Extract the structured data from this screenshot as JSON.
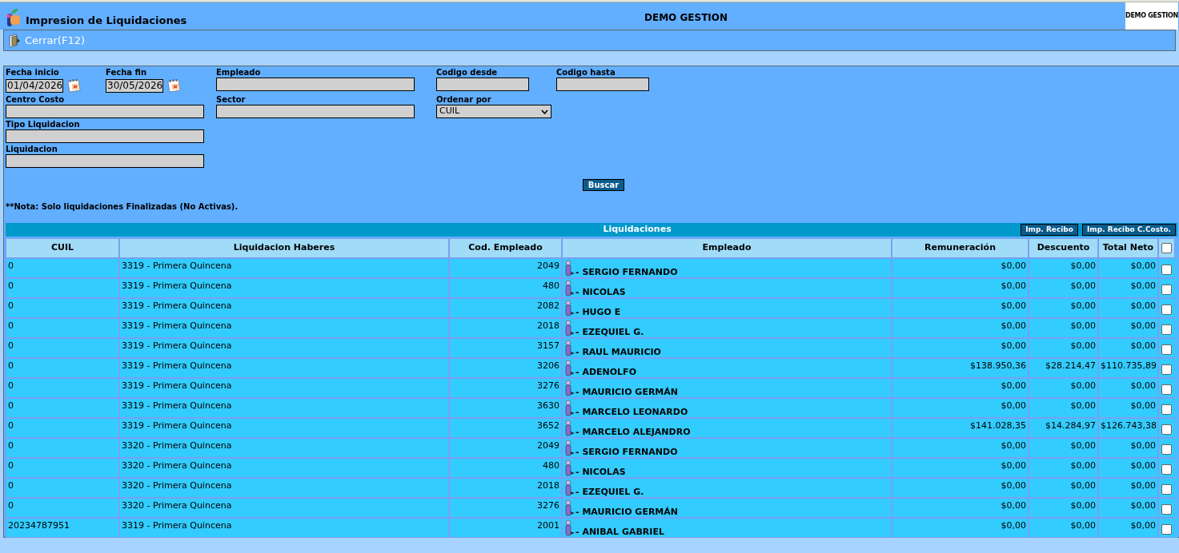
{
  "header": {
    "title": "Impresion de Liquidaciones",
    "company": "DEMO GESTION",
    "logo_text": "DEMO GESTION"
  },
  "toolbar": [
    {
      "label": "Cerrar(F12)"
    }
  ],
  "filters": [
    [
      {
        "label": "Fecha inicio",
        "kind": "date",
        "value": "01/04/2026"
      },
      {
        "label": "Fecha fin",
        "kind": "date",
        "value": "30/05/2026"
      },
      {
        "label": "Empleado",
        "kind": "text"
      },
      {
        "label": "Codigo desde",
        "kind": "short"
      },
      {
        "label": "Codigo hasta",
        "kind": "short"
      }
    ],
    [
      {
        "label": "Centro Costo",
        "kind": "text"
      },
      {
        "label": "Sector",
        "kind": "text"
      },
      {
        "label": "Ordenar por",
        "kind": "select",
        "value": "CUIL"
      }
    ],
    [
      {
        "label": "Tipo Liquidacion",
        "kind": "text"
      }
    ],
    [
      {
        "label": "Liquidacion",
        "kind": "text"
      }
    ]
  ],
  "search_button": "Buscar",
  "note": "**Nota: Solo liquidaciones Finalizadas (No Activas).",
  "table": {
    "title": "Liquidaciones",
    "actions": [
      "Imp. Recibo",
      "Imp. Recibo C.Costo."
    ],
    "columns": [
      "CUIL",
      "Liquidacion Haberes",
      "Cod. Empleado",
      "Empleado",
      "Remuneración",
      "Descuento",
      "Total Neto"
    ],
    "select_all_checked": false,
    "rows": [
      {
        "cuil": "0",
        "liquidacion": "3319 - Primera Quincena",
        "codigo": "2049",
        "empleado": "- SERGIO FERNANDO",
        "remuneracion": "$0,00",
        "descuento": "$0,00",
        "neto": "$0,00",
        "checked": false
      },
      {
        "cuil": "0",
        "liquidacion": "3319 - Primera Quincena",
        "codigo": "480",
        "empleado": "- NICOLAS",
        "remuneracion": "$0,00",
        "descuento": "$0,00",
        "neto": "$0,00",
        "checked": false
      },
      {
        "cuil": "0",
        "liquidacion": "3319 - Primera Quincena",
        "codigo": "2082",
        "empleado": "- HUGO E",
        "remuneracion": "$0,00",
        "descuento": "$0,00",
        "neto": "$0,00",
        "checked": false
      },
      {
        "cuil": "0",
        "liquidacion": "3319 - Primera Quincena",
        "codigo": "2018",
        "empleado": "- EZEQUIEL G.",
        "remuneracion": "$0,00",
        "descuento": "$0,00",
        "neto": "$0,00",
        "checked": false
      },
      {
        "cuil": "0",
        "liquidacion": "3319 - Primera Quincena",
        "codigo": "3157",
        "empleado": "- RAUL MAURICIO",
        "remuneracion": "$0,00",
        "descuento": "$0,00",
        "neto": "$0,00",
        "checked": false
      },
      {
        "cuil": "0",
        "liquidacion": "3319 - Primera Quincena",
        "codigo": "3206",
        "empleado": "- ADENOLFO",
        "remuneracion": "$138.950,36",
        "descuento": "$28.214,47",
        "neto": "$110.735,89",
        "checked": false
      },
      {
        "cuil": "0",
        "liquidacion": "3319 - Primera Quincena",
        "codigo": "3276",
        "empleado": "- MAURICIO GERMÁN",
        "remuneracion": "$0,00",
        "descuento": "$0,00",
        "neto": "$0,00",
        "checked": false
      },
      {
        "cuil": "0",
        "liquidacion": "3319 - Primera Quincena",
        "codigo": "3630",
        "empleado": "- MARCELO LEONARDO",
        "remuneracion": "$0,00",
        "descuento": "$0,00",
        "neto": "$0,00",
        "checked": false
      },
      {
        "cuil": "0",
        "liquidacion": "3319 - Primera Quincena",
        "codigo": "3652",
        "empleado": "- MARCELO ALEJANDRO",
        "remuneracion": "$141.028,35",
        "descuento": "$14.284,97",
        "neto": "$126.743,38",
        "checked": false
      },
      {
        "cuil": "0",
        "liquidacion": "3320 - Primera Quincena",
        "codigo": "2049",
        "empleado": "- SERGIO FERNANDO",
        "remuneracion": "$0,00",
        "descuento": "$0,00",
        "neto": "$0,00",
        "checked": false
      },
      {
        "cuil": "0",
        "liquidacion": "3320 - Primera Quincena",
        "codigo": "480",
        "empleado": "- NICOLAS",
        "remuneracion": "$0,00",
        "descuento": "$0,00",
        "neto": "$0,00",
        "checked": false
      },
      {
        "cuil": "0",
        "liquidacion": "3320 - Primera Quincena",
        "codigo": "2018",
        "empleado": "- EZEQUIEL G.",
        "remuneracion": "$0,00",
        "descuento": "$0,00",
        "neto": "$0,00",
        "checked": false
      },
      {
        "cuil": "0",
        "liquidacion": "3320 - Primera Quincena",
        "codigo": "3276",
        "empleado": "- MAURICIO GERMÁN",
        "remuneracion": "$0,00",
        "descuento": "$0,00",
        "neto": "$0,00",
        "checked": false
      },
      {
        "cuil": "20234787951",
        "liquidacion": "3319 - Primera Quincena",
        "codigo": "2001",
        "empleado": "- ANIBAL GABRIEL",
        "remuneracion": "$0,00",
        "descuento": "$0,00",
        "neto": "$0,00",
        "checked": false
      }
    ]
  }
}
